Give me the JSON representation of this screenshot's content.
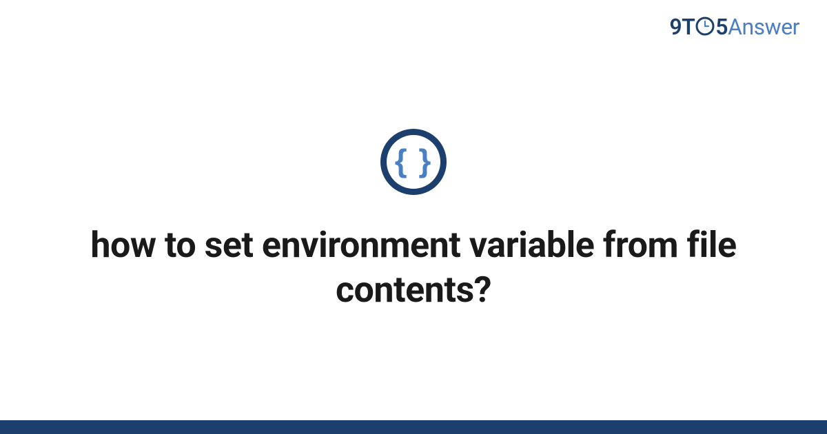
{
  "logo": {
    "part1": "9T",
    "part2": "5",
    "part3": "Answer"
  },
  "icon": {
    "symbol": "{ }",
    "name": "braces-icon"
  },
  "title": "how to set environment variable from file contents?",
  "colors": {
    "dark_blue": "#1c3f6e",
    "light_blue": "#4a7fc4"
  }
}
